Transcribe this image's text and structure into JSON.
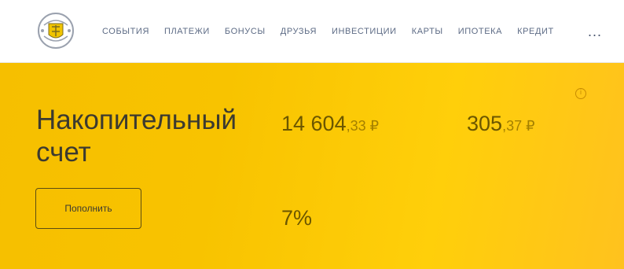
{
  "header": {
    "logo_icon": "bank-shield-emblem-icon",
    "nav": [
      "События",
      "Платежи",
      "Бонусы",
      "Друзья",
      "Инвестиции",
      "Карты",
      "Ипотека",
      "Кредит"
    ],
    "more_label": "..."
  },
  "account": {
    "caption": "",
    "name": "Накопительный счет",
    "balance_caption": "",
    "balance_main": "14 604",
    "balance_fraction": ",33 ₽",
    "interest_caption": "",
    "interest_main": "305",
    "interest_fraction": ",37 ₽",
    "info_icon": "info-icon",
    "rate_caption": "",
    "rate": "7%",
    "topup_label": "Пополнить"
  },
  "colors": {
    "accent": "#f8c300",
    "accent_light": "#ffcf0a",
    "text_dark": "#3c3a30",
    "nav_text": "#5d6b85"
  }
}
